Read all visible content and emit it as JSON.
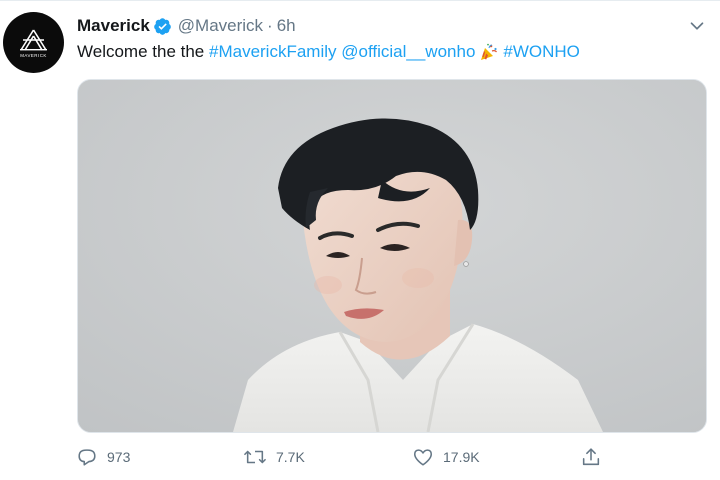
{
  "tweet": {
    "display_name": "Maverick",
    "handle": "@Maverick",
    "separator": "·",
    "time": "6h",
    "text_prefix": "Welcome the the",
    "hashtag_family": "#MaverickFamily",
    "mention": "@official__wonho",
    "hashtag_wonho": "#WONHO",
    "emoji": "party-popper"
  },
  "avatar": {
    "logo_text": "MAVERICK"
  },
  "actions": {
    "reply_count": "973",
    "retweet_count": "7.7K",
    "like_count": "17.9K"
  },
  "colors": {
    "accent": "#1da1f2",
    "secondary_text": "#657786",
    "primary_text": "#14171a"
  },
  "icons": [
    "verified-badge-icon",
    "chevron-down-icon",
    "reply-icon",
    "retweet-icon",
    "like-icon",
    "share-icon"
  ]
}
